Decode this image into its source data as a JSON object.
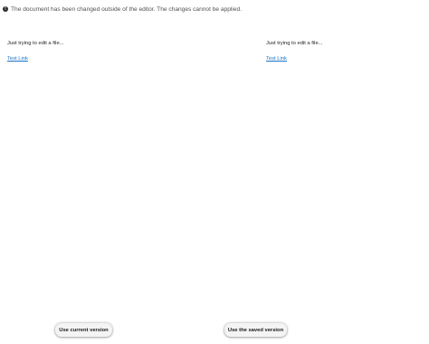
{
  "notice": {
    "icon": "info-icon",
    "text": "The document has been changed outside of the editor. The changes cannot be applied."
  },
  "left_pane": {
    "text": "Just trying to edit a file...",
    "link": "Test Link"
  },
  "right_pane": {
    "text": "Just trying to edit a file...",
    "link": "Test Link"
  },
  "buttons": {
    "use_current": "Use current version",
    "use_saved": "Use the saved version"
  }
}
